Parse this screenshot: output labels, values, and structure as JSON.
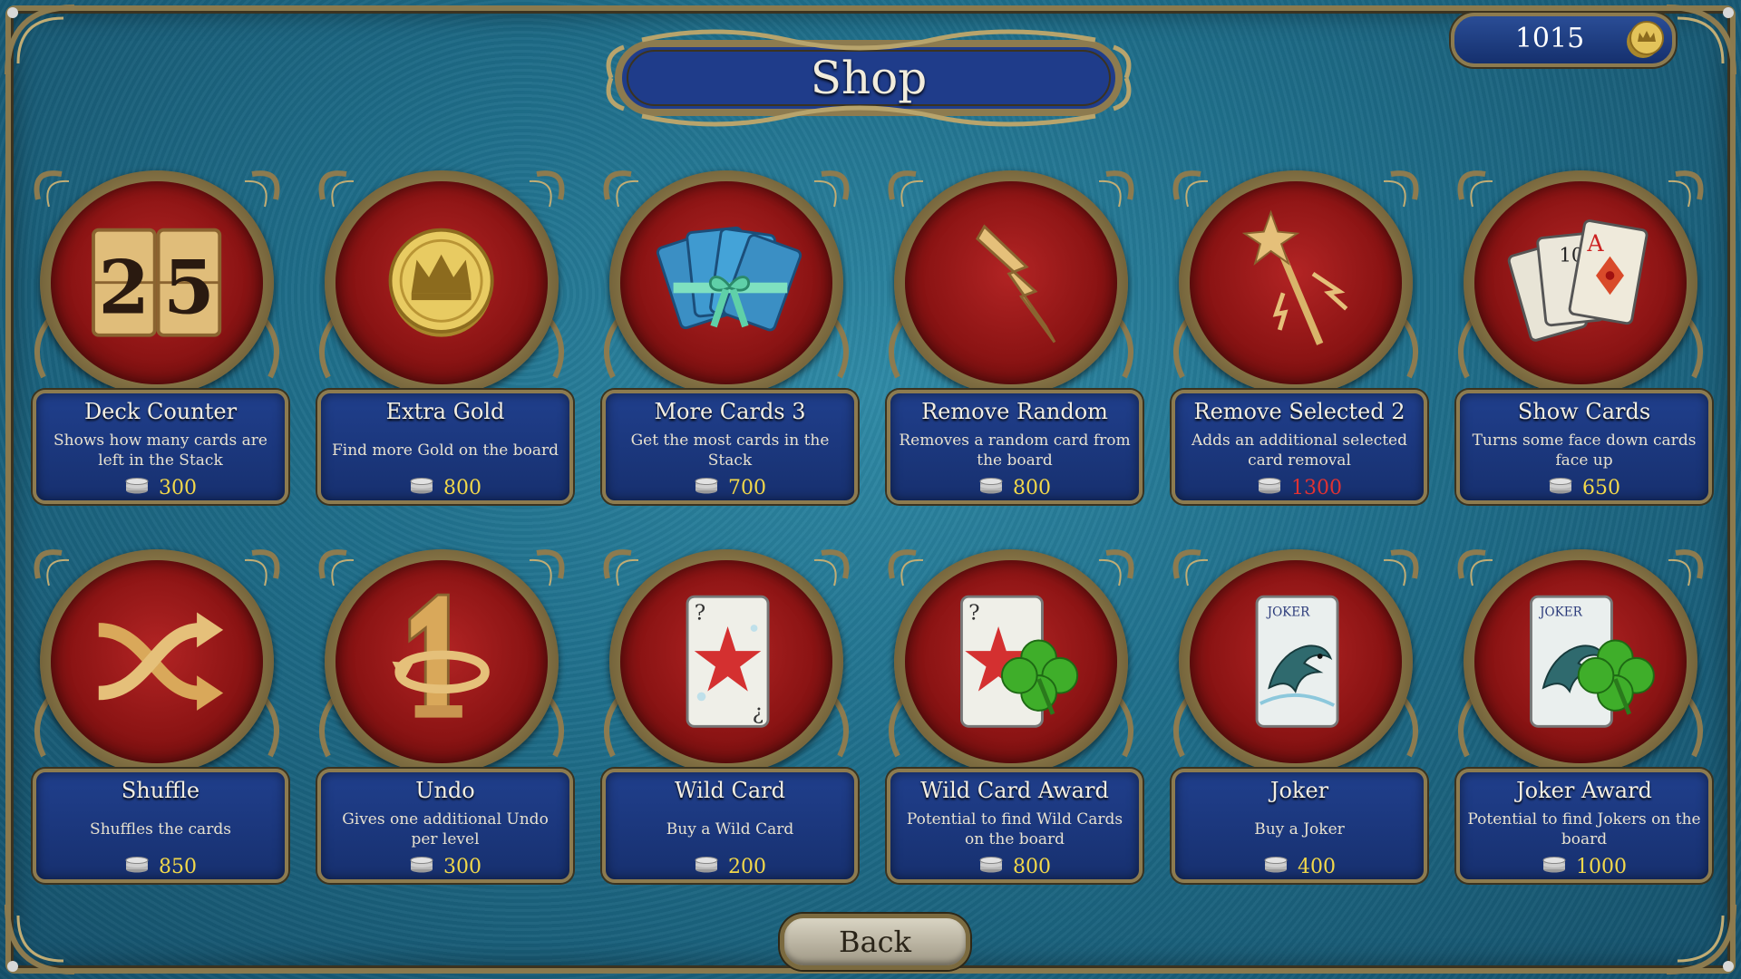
{
  "title": "Shop",
  "gold": "1015",
  "back_label": "Back",
  "colors": {
    "price_affordable": "#f2d84a",
    "price_insufficient": "#e03232"
  },
  "items": [
    {
      "name": "Deck Counter",
      "desc": "Shows how many cards are left in the Stack",
      "price": "300",
      "affordable": true,
      "icon": "deck-counter-icon"
    },
    {
      "name": "Extra Gold",
      "desc": "Find more Gold on the board",
      "price": "800",
      "affordable": true,
      "icon": "gold-coin-icon"
    },
    {
      "name": "More Cards 3",
      "desc": "Get the most cards in the Stack",
      "price": "700",
      "affordable": true,
      "icon": "gift-cards-icon"
    },
    {
      "name": "Remove Random",
      "desc": "Removes a random card from the board",
      "price": "800",
      "affordable": true,
      "icon": "lightning-icon"
    },
    {
      "name": "Remove Selected 2",
      "desc": "Adds an additional selected card removal",
      "price": "1300",
      "affordable": false,
      "icon": "magic-wand-icon"
    },
    {
      "name": "Show Cards",
      "desc": "Turns some face down cards face up",
      "price": "650",
      "affordable": true,
      "icon": "playing-cards-icon"
    },
    {
      "name": "Shuffle",
      "desc": "Shuffles the cards",
      "price": "850",
      "affordable": true,
      "icon": "shuffle-icon"
    },
    {
      "name": "Undo",
      "desc": "Gives one additional Undo per level",
      "price": "300",
      "affordable": true,
      "icon": "undo-one-icon"
    },
    {
      "name": "Wild Card",
      "desc": "Buy a Wild Card",
      "price": "200",
      "affordable": true,
      "icon": "wild-card-icon"
    },
    {
      "name": "Wild Card Award",
      "desc": "Potential to find Wild Cards on the board",
      "price": "800",
      "affordable": true,
      "icon": "wild-card-clover-icon"
    },
    {
      "name": "Joker",
      "desc": "Buy a Joker",
      "price": "400",
      "affordable": true,
      "icon": "joker-card-icon"
    },
    {
      "name": "Joker Award",
      "desc": "Potential to find Jokers on the board",
      "price": "1000",
      "affordable": true,
      "icon": "joker-card-clover-icon"
    }
  ]
}
